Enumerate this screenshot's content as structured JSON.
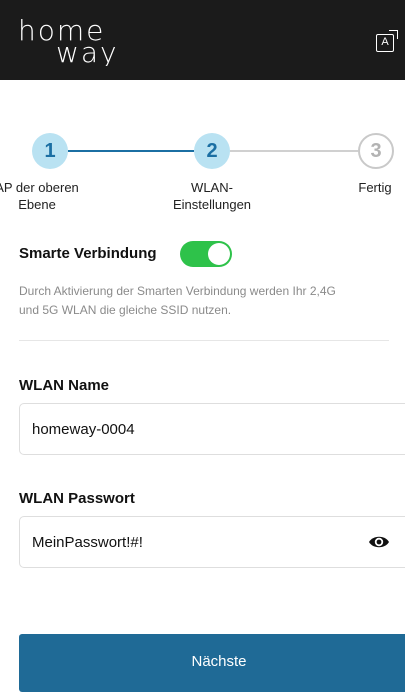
{
  "header": {
    "logo_line1": "home",
    "logo_line2": "way",
    "language_icon": "translate-icon",
    "language_icon_text": "A",
    "background_color": "#1b1b1b"
  },
  "stepper": {
    "steps": [
      {
        "number": "1",
        "label_line1": "AP der oberen",
        "label_line2": "Ebene",
        "state": "done"
      },
      {
        "number": "2",
        "label_line1": "WLAN-",
        "label_line2": "Einstellungen",
        "state": "current"
      },
      {
        "number": "3",
        "label_line1": "Fertig",
        "label_line2": "",
        "state": "pending"
      }
    ],
    "active_color": "#1b6fa3",
    "active_bg": "#b9e2f2"
  },
  "smart_connection": {
    "title": "Smarte Verbindung",
    "enabled": true,
    "toggle_color": "#2ec24a",
    "description_line1": "Durch Aktivierung der Smarten Verbindung werden Ihr 2,4G",
    "description_line2": "und 5G WLAN die gleiche SSID nutzen."
  },
  "wlan_name": {
    "label": "WLAN Name",
    "value": "homeway-0004"
  },
  "wlan_password": {
    "label": "WLAN Passwort",
    "value": "MeinPasswort!#!",
    "visibility_icon": "eye-icon"
  },
  "next_button": {
    "label": "Nächste",
    "color": "#1f6a96"
  }
}
